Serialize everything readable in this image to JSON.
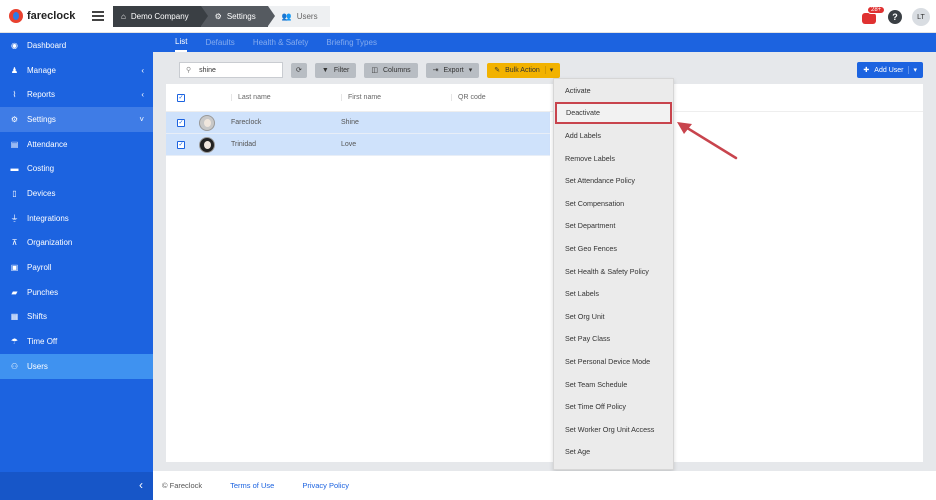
{
  "app": {
    "brand": "fareclock"
  },
  "breadcrumbs": [
    {
      "label": "Demo Company",
      "icon": "home-icon"
    },
    {
      "label": "Settings",
      "icon": "gear-icon"
    },
    {
      "label": "Users",
      "icon": "users-icon"
    }
  ],
  "header": {
    "notification_count": "28+",
    "help_label": "?",
    "user_initials": "LT"
  },
  "sidebar": {
    "items": [
      {
        "label": "Dashboard",
        "icon": "dashboard-icon"
      },
      {
        "label": "Manage",
        "icon": "person-icon",
        "chevron": "‹"
      },
      {
        "label": "Reports",
        "icon": "chart-icon",
        "chevron": "‹"
      },
      {
        "label": "Settings",
        "icon": "gear-icon",
        "chevron": "˅"
      },
      {
        "label": "Attendance",
        "icon": "id-card-icon"
      },
      {
        "label": "Costing",
        "icon": "folder-icon"
      },
      {
        "label": "Devices",
        "icon": "tablet-icon"
      },
      {
        "label": "Integrations",
        "icon": "plug-icon"
      },
      {
        "label": "Organization",
        "icon": "sitemap-icon"
      },
      {
        "label": "Payroll",
        "icon": "money-icon"
      },
      {
        "label": "Punches",
        "icon": "truck-icon"
      },
      {
        "label": "Shifts",
        "icon": "calendar-icon"
      },
      {
        "label": "Time Off",
        "icon": "umbrella-icon"
      },
      {
        "label": "Users",
        "icon": "users-icon"
      }
    ],
    "collapse_glyph": "‹"
  },
  "subtabs": [
    "List",
    "Defaults",
    "Health & Safety",
    "Briefing Types"
  ],
  "toolbar": {
    "search_value": "shine",
    "filter_label": "Filter",
    "columns_label": "Columns",
    "export_label": "Export",
    "bulk_action_label": "Bulk Action",
    "add_user_label": "Add User"
  },
  "grid": {
    "columns": [
      "Last name",
      "First name",
      "QR code"
    ],
    "rows": [
      {
        "last_name": "Fareclock",
        "first_name": "Shine"
      },
      {
        "last_name": "Trinidad",
        "first_name": "Love"
      }
    ]
  },
  "bulk_menu": {
    "items": [
      "Activate",
      "Deactivate",
      "Add Labels",
      "Remove Labels",
      "Set Attendance Policy",
      "Set Compensation",
      "Set Department",
      "Set Geo Fences",
      "Set Health & Safety Policy",
      "Set Labels",
      "Set Org Unit",
      "Set Pay Class",
      "Set Personal Device Mode",
      "Set Team Schedule",
      "Set Time Off Policy",
      "Set Worker Org Unit Access",
      "Set Age"
    ],
    "highlighted": "Deactivate",
    "highlight_color": "#c8444d"
  },
  "footer": {
    "copyright": "© Fareclock",
    "terms": "Terms of Use",
    "privacy": "Privacy Policy"
  },
  "colors": {
    "primary": "#1c63e0",
    "accent": "#f2b200",
    "annotation": "#c8444d"
  }
}
